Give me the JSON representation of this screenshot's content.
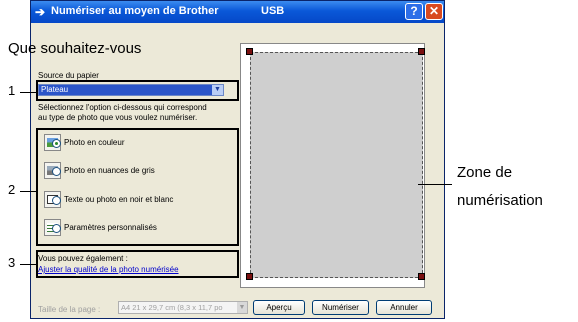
{
  "window": {
    "title": "Numériser au moyen de Brother",
    "subtitle": "USB",
    "help_btn": "?",
    "close_btn": "✕"
  },
  "panel": {
    "heading": "Que souhaitez-vous",
    "source_label": "Source du papier",
    "source_value": "Plateau",
    "instructions_line1": "Sélectionnez l'option ci-dessous qui correspond",
    "instructions_line2": "au type de photo que vous voulez numériser.",
    "options": [
      {
        "label": "Photo en couleur",
        "selected": true
      },
      {
        "label": "Photo en nuances de gris",
        "selected": false
      },
      {
        "label": "Texte ou photo en noir et blanc",
        "selected": false
      },
      {
        "label": "Paramètres personnalisés",
        "selected": false
      }
    ],
    "also_label": "Vous pouvez également :",
    "adjust_link": "Ajuster la qualité de la photo numérisée"
  },
  "footer": {
    "page_size_label": "Taille de la page :",
    "page_size_value": "A4 21 x 29,7 cm (8,3 x 11,7 po",
    "buttons": [
      "Aperçu",
      "Numériser",
      "Annuler"
    ]
  },
  "callouts": {
    "n1": "1",
    "n2": "2",
    "n3": "3",
    "zone_line1": "Zone de",
    "zone_line2": "numérisation"
  }
}
